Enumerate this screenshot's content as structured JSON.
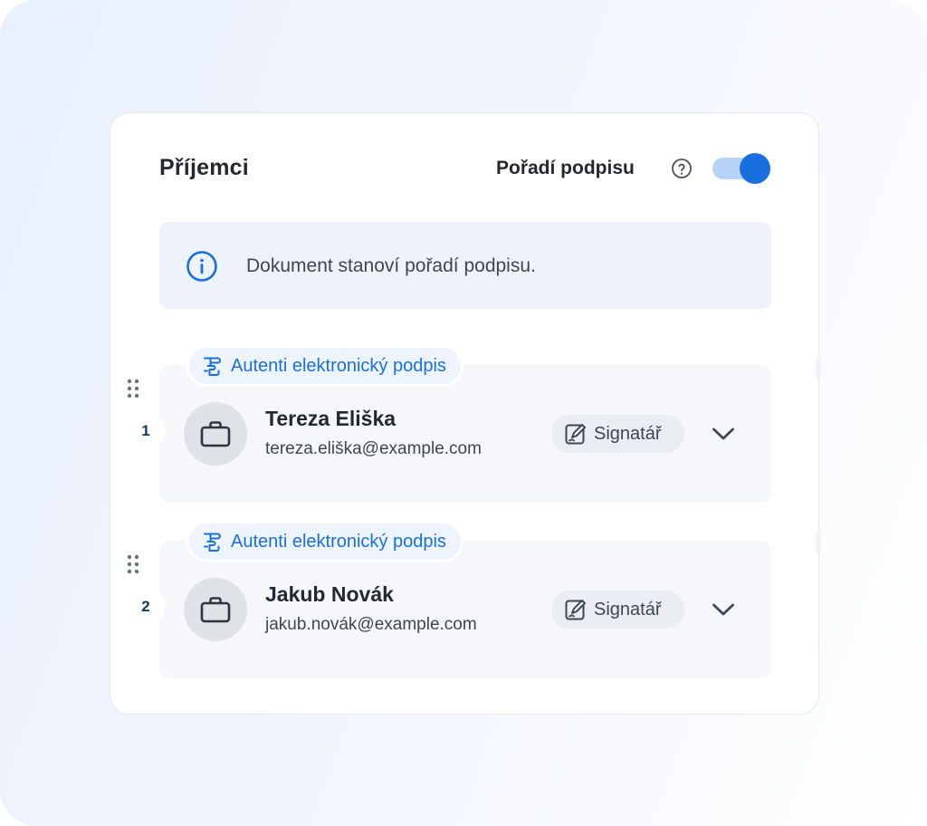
{
  "panel": {
    "title": "Příjemci",
    "signing_order_label": "Pořadí podpisu",
    "signing_order_enabled": true,
    "accent_color": "#1a6fe0"
  },
  "info": {
    "message": "Dokument stanoví pořadí podpisu."
  },
  "recipients": [
    {
      "order": "1",
      "signature_type": "Autenti elektronický podpis",
      "name": "Tereza Eliška",
      "email": "tereza.eliška@example.com",
      "role": "Signatář",
      "avatar_icon": "briefcase-icon"
    },
    {
      "order": "2",
      "signature_type": "Autenti elektronický podpis",
      "name": "Jakub Novák",
      "email": "jakub.novák@example.com",
      "role": "Signatář",
      "avatar_icon": "briefcase-icon"
    }
  ]
}
